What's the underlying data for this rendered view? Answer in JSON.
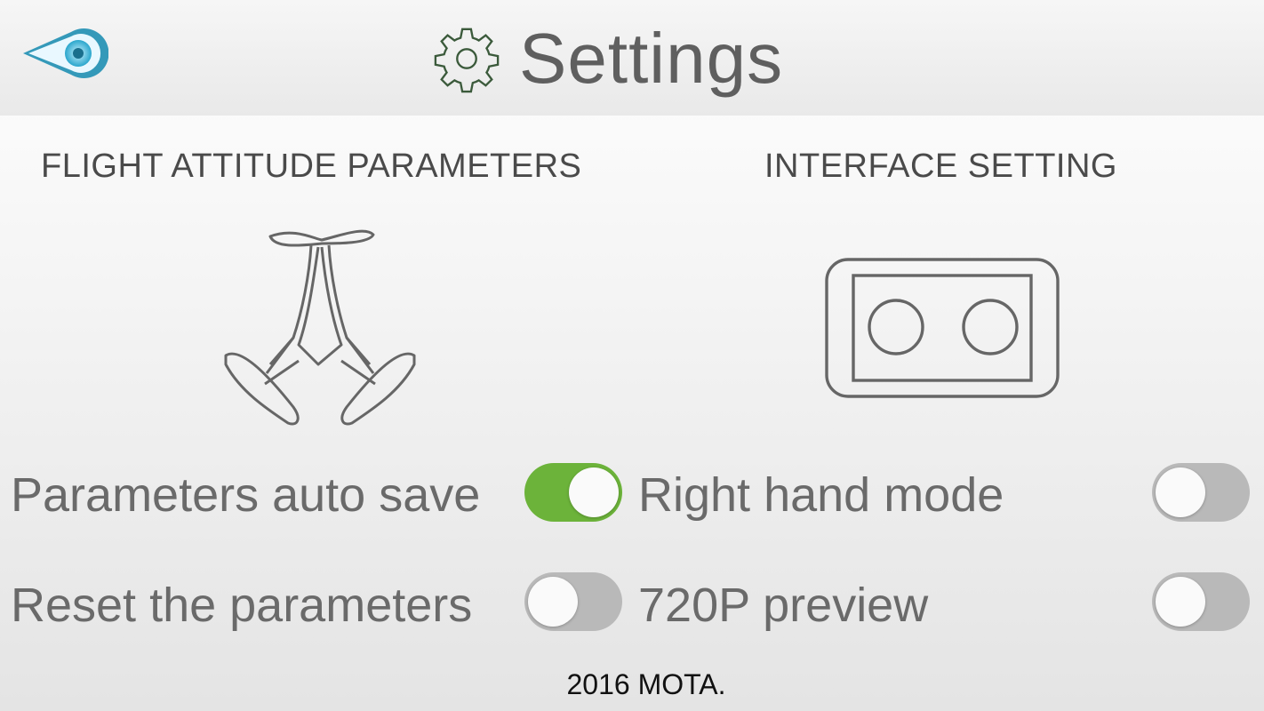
{
  "header": {
    "title": "Settings",
    "back_icon": "back-arrow-eye-icon",
    "settings_icon": "gear-icon"
  },
  "sections": {
    "flight": {
      "heading": "FLIGHT ATTITUDE PARAMETERS",
      "illustration": "drone-icon"
    },
    "interface": {
      "heading": "INTERFACE SETTING",
      "illustration": "gamepad-icon"
    }
  },
  "settings": {
    "auto_save": {
      "label": "Parameters auto save",
      "on": true
    },
    "reset": {
      "label": "Reset the parameters",
      "on": false
    },
    "right_hand": {
      "label": "Right hand mode",
      "on": false
    },
    "preview_720p": {
      "label": "720P preview",
      "on": false
    }
  },
  "footer": {
    "text": "2016 MOTA."
  },
  "colors": {
    "toggle_on": "#6cb33a",
    "toggle_off": "#b9b9b9",
    "back_accent": "#1f8fb3",
    "gear": "#3b5a3b"
  }
}
